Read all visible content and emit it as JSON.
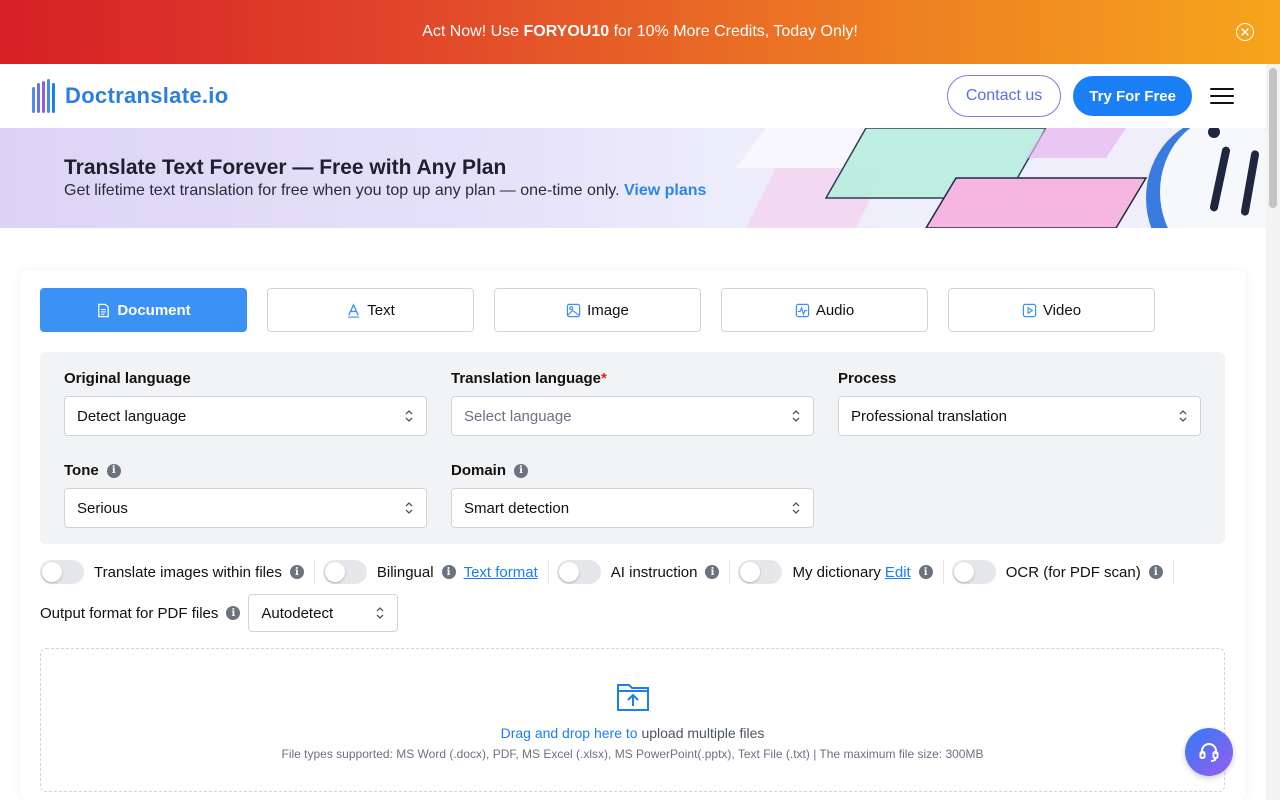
{
  "promo": {
    "text_before": "Act Now! Use ",
    "code": "FORYOU10",
    "text_after": " for 10% More Credits, Today Only!"
  },
  "header": {
    "logo_text": "Doctranslate.io",
    "contact_label": "Contact us",
    "try_label": "Try For Free"
  },
  "banner": {
    "title": "Translate Text Forever — Free with Any Plan",
    "subtitle": "Get lifetime text translation for free when you top up any plan — one-time only.",
    "link": "View plans"
  },
  "tabs": [
    {
      "label": "Document",
      "icon": "document-icon",
      "active": true
    },
    {
      "label": "Text",
      "icon": "text-icon",
      "active": false
    },
    {
      "label": "Image",
      "icon": "image-icon",
      "active": false
    },
    {
      "label": "Audio",
      "icon": "audio-icon",
      "active": false
    },
    {
      "label": "Video",
      "icon": "video-icon",
      "active": false
    }
  ],
  "fields": {
    "original_language": {
      "label": "Original language",
      "value": "Detect language"
    },
    "translation_language": {
      "label": "Translation language",
      "required_mark": "*",
      "placeholder": "Select language"
    },
    "process": {
      "label": "Process",
      "value": "Professional translation"
    },
    "tone": {
      "label": "Tone",
      "value": "Serious"
    },
    "domain": {
      "label": "Domain",
      "value": "Smart detection"
    }
  },
  "toggles": {
    "translate_images": "Translate images within files",
    "bilingual": "Bilingual",
    "text_format": "Text format",
    "ai_instruction": "AI instruction",
    "my_dictionary": "My dictionary",
    "edit": "Edit",
    "ocr": "OCR (for PDF scan)"
  },
  "pdf_output": {
    "label": "Output format for PDF files",
    "value": "Autodetect"
  },
  "dropzone": {
    "highlight": "Drag and drop here to",
    "rest": " upload multiple files",
    "supported": "File types supported: MS Word (.docx), PDF, MS Excel (.xlsx), MS PowerPoint(.pptx), Text File (.txt) | The maximum file size: 300MB"
  },
  "colors": {
    "brand_blue": "#1a7ef5",
    "tab_active": "#3c91f5",
    "promo_start": "#d61f26",
    "promo_end": "#f6a51c"
  }
}
